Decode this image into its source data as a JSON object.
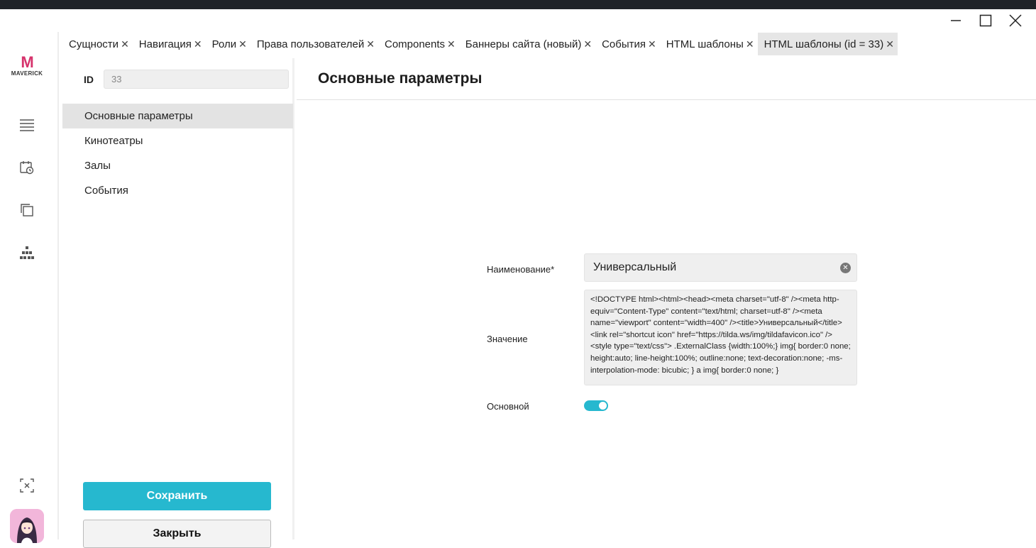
{
  "window": {
    "minimize_icon": "minimize-icon",
    "maximize_icon": "maximize-icon",
    "close_icon": "close-icon"
  },
  "brand": {
    "logo_letter": "M",
    "logo_word": "MAVERICK"
  },
  "rail": {
    "icons": [
      "menu-icon",
      "calendar-clock-icon",
      "copy-icon",
      "hierarchy-icon",
      "fullscreen-exit-icon"
    ]
  },
  "tabs": [
    {
      "label": "Сущности",
      "close": "✕"
    },
    {
      "label": "Навигация",
      "close": "✕"
    },
    {
      "label": "Роли",
      "close": "✕"
    },
    {
      "label": "Права пользователей",
      "close": "✕"
    },
    {
      "label": "Components",
      "close": "✕"
    },
    {
      "label": "Баннеры сайта (новый)",
      "close": "✕"
    },
    {
      "label": "События",
      "close": "✕"
    },
    {
      "label": "HTML шаблоны",
      "close": "✕"
    },
    {
      "label": "HTML шаблоны (id = 33)",
      "close": "✕",
      "active": true
    }
  ],
  "left": {
    "id_label": "ID",
    "id_value": "33",
    "nav": [
      {
        "label": "Основные параметры",
        "active": true
      },
      {
        "label": "Кинотеатры"
      },
      {
        "label": "Залы"
      },
      {
        "label": "События"
      }
    ],
    "save_label": "Сохранить",
    "close_label": "Закрыть"
  },
  "main": {
    "title": "Основные параметры",
    "name_label": "Наименование*",
    "name_value": "Универсальный",
    "value_label": "Значение",
    "value_text": "<!DOCTYPE html><html><head><meta charset=\"utf-8\" /><meta http-equiv=\"Content-Type\" content=\"text/html; charset=utf-8\" /><meta name=\"viewport\" content=\"width=400\" /><title>Универсальный</title><link rel=\"shortcut icon\" href=\"https://tilda.ws/img/tildafavicon.ico\" /><style type=\"text/css\"> .ExternalClass {width:100%;}    img{ border:0 none; height:auto; line-height:100%; outline:none; text-decoration:none; -ms-interpolation-mode: bicubic;   }       a img{ border:0 none;     }",
    "primary_label": "Основной",
    "primary_on": true
  },
  "colors": {
    "accent": "#26b8cf",
    "brand_pink": "#d6336c"
  }
}
